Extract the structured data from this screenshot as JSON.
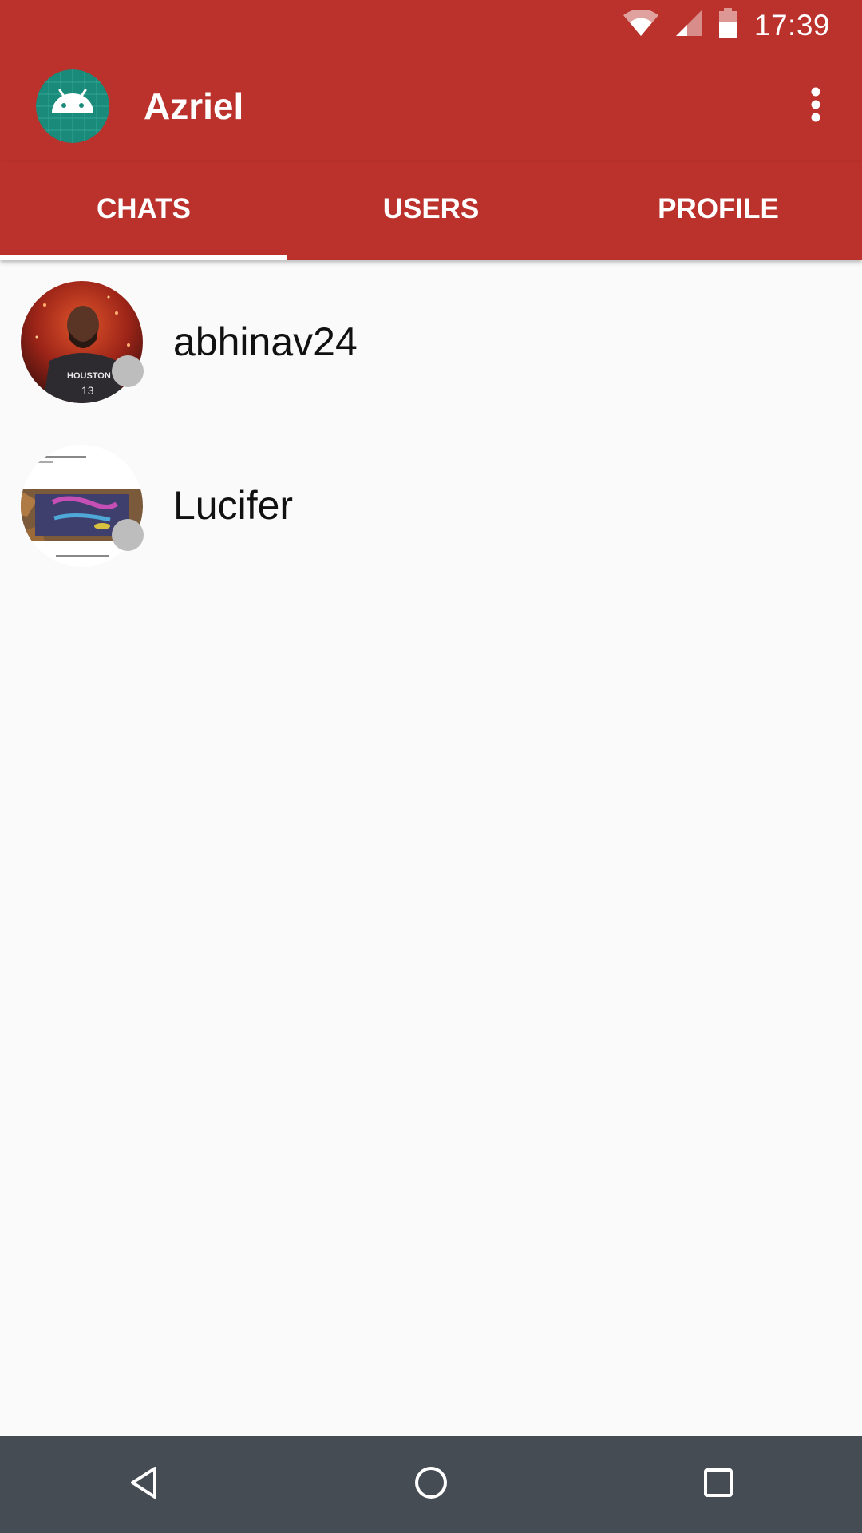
{
  "status_bar": {
    "time": "17:39",
    "icons": [
      "wifi-icon",
      "cell-signal-icon",
      "battery-icon"
    ]
  },
  "app_bar": {
    "title": "Azriel",
    "avatar_icon": "android-icon",
    "menu_icon": "more-vert-icon"
  },
  "tabs": [
    {
      "label": "CHATS",
      "selected": true
    },
    {
      "label": "USERS",
      "selected": false
    },
    {
      "label": "PROFILE",
      "selected": false
    }
  ],
  "chats": [
    {
      "name": "abhinav24",
      "online": false
    },
    {
      "name": "Lucifer",
      "online": false
    }
  ],
  "nav_bar": {
    "icons": [
      "back-icon",
      "home-icon",
      "recents-icon"
    ]
  },
  "colors": {
    "primary": "#bb312c",
    "background": "#fafafa",
    "nav_bar": "#454c53",
    "status_dot": "#bdbdbd",
    "app_avatar_bg": "#1a8a7a"
  }
}
